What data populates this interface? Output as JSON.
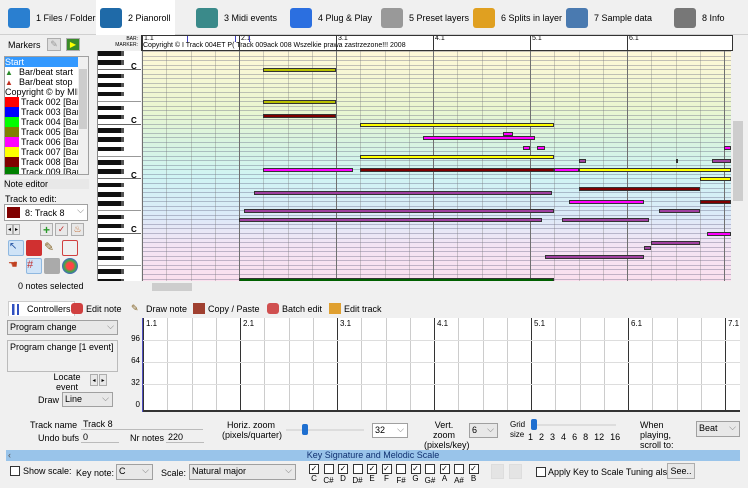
{
  "tabs": [
    {
      "label": "1 Files / Folders",
      "icon": "folder-icon",
      "color": "#2a7fd0"
    },
    {
      "label": "2 Pianoroll",
      "icon": "pianoroll-icon",
      "color": "#1f6aa8",
      "selected": true
    },
    {
      "label": "3 Midi events",
      "icon": "midi-events-icon",
      "color": "#3a8a8a"
    },
    {
      "label": "4 Plug & Play",
      "icon": "plug-play-icon",
      "color": "#2b6fe0"
    },
    {
      "label": "5 Preset layers",
      "icon": "preset-layers-icon",
      "color": "#888"
    },
    {
      "label": "6 Splits in layer",
      "icon": "splits-icon",
      "color": "#e0a020"
    },
    {
      "label": "7 Sample data",
      "icon": "sample-data-icon",
      "color": "#4a7ab0"
    },
    {
      "label": "8 Info",
      "icon": "info-icon",
      "color": "#666"
    }
  ],
  "markers": {
    "label": "Markers",
    "items": [
      {
        "label": "Start",
        "selected": true
      },
      {
        "label": "Bar/beat start",
        "icon": "bar-beat-start-icon",
        "color": "#2a8a2a"
      },
      {
        "label": "Bar/beat stop",
        "icon": "bar-beat-stop-icon",
        "color": "#c03020"
      },
      {
        "label": "Copyright © by MID"
      },
      {
        "label": "Track 002 [Bar",
        "color": "#ff0000"
      },
      {
        "label": "Track 003 [Bar",
        "color": "#0000ff"
      },
      {
        "label": "Track 004 [Bar",
        "color": "#00ff00"
      },
      {
        "label": "Track 005 [Bar",
        "color": "#808000"
      },
      {
        "label": "Track 006 [Bar",
        "color": "#ff00ff"
      },
      {
        "label": "Track 007 [Bar",
        "color": "#ffff00"
      },
      {
        "label": "Track 008 [Bar",
        "color": "#800000"
      },
      {
        "label": "Track 009 [Bar",
        "color": "#008000"
      }
    ]
  },
  "note_editor": {
    "title": "Note editor",
    "track_label": "Track to edit:",
    "track_value": "8: Track 8",
    "track_color": "#800000",
    "status": "0 notes selected"
  },
  "ruler": {
    "bar_label": "BAR:",
    "marker_label": "MARKER:",
    "bars": [
      "1.1",
      "2.1",
      "3.1",
      "4.1",
      "5.1",
      "6.1"
    ],
    "marker_text": "Copyright © I Track 004ET P( Track 009ack 008 Wszelkie prawa zastrzezone!!! 2008"
  },
  "keyboard": {
    "c_label": "C"
  },
  "notes": [
    {
      "row": 4,
      "start": 5,
      "end": 8,
      "color": "#b8c000"
    },
    {
      "row": 11,
      "start": 5,
      "end": 8,
      "color": "#b8c000"
    },
    {
      "row": 14,
      "start": 5,
      "end": 8,
      "color": "#800000"
    },
    {
      "row": 16,
      "start": 9,
      "end": 17,
      "color": "#ffff00"
    },
    {
      "row": 18,
      "start": 14.9,
      "end": 15.3,
      "color": "#ff00ff"
    },
    {
      "row": 19,
      "start": 11.6,
      "end": 16.2,
      "color": "#ff00ff"
    },
    {
      "row": 21,
      "start": 15.7,
      "end": 16,
      "color": "#ff00ff"
    },
    {
      "row": 21,
      "start": 16.3,
      "end": 16.6,
      "color": "#ff00ff"
    },
    {
      "row": 21,
      "start": 24,
      "end": 24.3,
      "color": "#ff00ff"
    },
    {
      "row": 23,
      "start": 9,
      "end": 17,
      "color": "#ffff00"
    },
    {
      "row": 24,
      "start": 18,
      "end": 18.3,
      "color": "#a040a0"
    },
    {
      "row": 24,
      "start": 22,
      "end": 22.1,
      "color": "#a040a0"
    },
    {
      "row": 24,
      "start": 23.5,
      "end": 24.3,
      "color": "#a040a0"
    },
    {
      "row": 26,
      "start": 5,
      "end": 8.7,
      "color": "#ff00ff"
    },
    {
      "row": 26,
      "start": 9,
      "end": 17,
      "color": "#800000"
    },
    {
      "row": 26,
      "start": 17,
      "end": 18,
      "color": "#ff00ff"
    },
    {
      "row": 26,
      "start": 18,
      "end": 24.3,
      "color": "#ffff00"
    },
    {
      "row": 28,
      "start": 23,
      "end": 24.3,
      "color": "#ffff00"
    },
    {
      "row": 30,
      "start": 18,
      "end": 23,
      "color": "#800000"
    },
    {
      "row": 31,
      "start": 4.6,
      "end": 16.9,
      "color": "#a040a0"
    },
    {
      "row": 33,
      "start": 17.6,
      "end": 20.7,
      "color": "#ff00ff"
    },
    {
      "row": 33,
      "start": 23,
      "end": 24.3,
      "color": "#800000"
    },
    {
      "row": 35,
      "start": 4.2,
      "end": 17,
      "color": "#a040a0"
    },
    {
      "row": 35,
      "start": 21.3,
      "end": 23,
      "color": "#a040a0"
    },
    {
      "row": 37,
      "start": 4,
      "end": 16.5,
      "color": "#a040a0"
    },
    {
      "row": 37,
      "start": 17.3,
      "end": 20.9,
      "color": "#a040a0"
    },
    {
      "row": 40,
      "start": 23.3,
      "end": 24.3,
      "color": "#ff00ff"
    },
    {
      "row": 42,
      "start": 21,
      "end": 23,
      "color": "#a040a0"
    },
    {
      "row": 43,
      "start": 20.7,
      "end": 21,
      "color": "#a040a0"
    },
    {
      "row": 45,
      "start": 16.6,
      "end": 20.7,
      "color": "#a040a0"
    },
    {
      "row": 50,
      "start": 4,
      "end": 17,
      "color": "#006000"
    }
  ],
  "bottom_tabs": [
    {
      "label": "Controllers",
      "icon": "controllers-icon",
      "selected": true
    },
    {
      "label": "Edit note",
      "icon": "edit-note-icon"
    },
    {
      "label": "Draw note",
      "icon": "pencil-icon"
    },
    {
      "label": "Copy / Paste",
      "icon": "copy-paste-icon"
    },
    {
      "label": "Batch edit",
      "icon": "batch-edit-icon"
    },
    {
      "label": "Edit track",
      "icon": "edit-track-icon"
    }
  ],
  "controllers": {
    "type": "Program change",
    "info": "Program change [1 event]",
    "locate_label": "Locate event",
    "draw_label": "Draw",
    "draw_value": "Line",
    "y_ticks": [
      "96",
      "64",
      "32",
      "0"
    ],
    "bars": [
      "1.1",
      "2.1",
      "3.1",
      "4.1",
      "5.1",
      "6.1",
      "7.1"
    ]
  },
  "track": {
    "name_label": "Track name",
    "name_value": "Track 8",
    "undo_label": "Undo bufs",
    "undo_value": "0",
    "notes_label": "Nr notes",
    "notes_value": "220"
  },
  "zoom": {
    "horiz_label": "Horiz. zoom (pixels/quarter)",
    "horiz_value": "32",
    "horiz_slider": 0.2,
    "vert_label": "Vert. zoom (pixels/key)",
    "vert_value": "6",
    "grid_label": "Grid size",
    "grid_values": [
      "1",
      "2",
      "3",
      "4",
      "6",
      "8",
      "12",
      "16"
    ],
    "grid_selected": "1",
    "scroll_label": "When playing, scroll to:",
    "scroll_value": "Beat"
  },
  "keysig": {
    "title": "Key Signature and Melodic Scale",
    "show_scale_label": "Show scale:",
    "key_note_label": "Key note:",
    "key_note_value": "C",
    "scale_label": "Scale:",
    "scale_value": "Natural major",
    "keys": [
      {
        "n": "C",
        "on": true
      },
      {
        "n": "C#",
        "on": false
      },
      {
        "n": "D",
        "on": true
      },
      {
        "n": "D#",
        "on": false
      },
      {
        "n": "E",
        "on": true
      },
      {
        "n": "F",
        "on": true
      },
      {
        "n": "F#",
        "on": false
      },
      {
        "n": "G",
        "on": true
      },
      {
        "n": "G#",
        "on": false
      },
      {
        "n": "A",
        "on": true
      },
      {
        "n": "A#",
        "on": false
      },
      {
        "n": "B",
        "on": true
      }
    ],
    "apply_label": "Apply Key to Scale Tuning also",
    "see_label": "See.."
  }
}
